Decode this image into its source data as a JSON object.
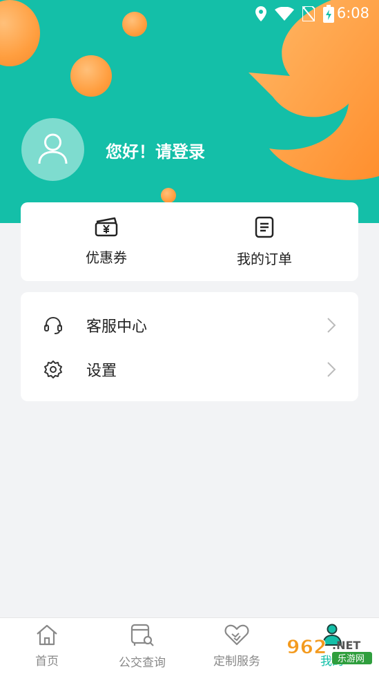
{
  "status_bar": {
    "time": "6:08"
  },
  "header": {
    "greeting": "您好！请登录"
  },
  "quick_actions": [
    {
      "label": "优惠券",
      "icon": "coupon-wallet-icon"
    },
    {
      "label": "我的订单",
      "icon": "order-document-icon"
    }
  ],
  "menu": [
    {
      "label": "客服中心",
      "icon": "headset-icon"
    },
    {
      "label": "设置",
      "icon": "gear-icon"
    }
  ],
  "tabbar": {
    "tabs": [
      {
        "label": "首页",
        "icon": "home-icon"
      },
      {
        "label": "公交查询",
        "icon": "bus-search-icon"
      },
      {
        "label": "定制服务",
        "icon": "handshake-heart-icon"
      },
      {
        "label": "我的",
        "icon": "person-icon"
      }
    ],
    "active_index": 3
  },
  "watermark": {
    "text": "962.NET",
    "subtext": "乐游网"
  },
  "colors": {
    "accent": "#14bfa8",
    "orange": "#ff9e3f",
    "background": "#f2f3f5"
  }
}
